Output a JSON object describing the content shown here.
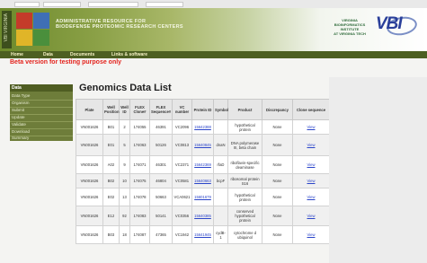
{
  "browser": {},
  "banner": {
    "side_label": "VBI VIRGINIA",
    "title_line1": "ADMINISTRATIVE RESOURCE FOR",
    "title_line2": "BIODEFENSE PROTEOMIC RESEARCH CENTERS",
    "vbi_sub_line1": "VIRGINIA",
    "vbi_sub_line2": "BIOINFORMATICS",
    "vbi_sub_line3": "INSTITUTE",
    "vbi_sub_line4": "AT VIRGINIA TECH",
    "vbi_logo": "VBI",
    "logo_colors": [
      "#c43b2a",
      "#3f6fb5",
      "#e0b528",
      "#4a8f3c"
    ]
  },
  "nav": {
    "items": [
      "Home",
      "Data",
      "Documents",
      "Links & software"
    ]
  },
  "beta_notice": "Beta version for testing purpose only",
  "sidebar": {
    "header": "Data",
    "items": [
      "Data Type",
      "Organism",
      "Submit",
      "Update",
      "Validate",
      "Download",
      "Summary"
    ]
  },
  "page_title": "Genomics Data List",
  "table": {
    "headers": [
      "Plate",
      "Well Position",
      "Well ID",
      "FLEX Clone#",
      "FLEX Sequence#",
      "VC number",
      "Protein ID",
      "Symbol",
      "Product",
      "Discrepancy",
      "Clone sequence"
    ],
    "rows": [
      [
        "VN001626",
        "B01",
        "2",
        "174055",
        "46391",
        "VC2096",
        "15642388",
        "",
        "hypothetical protein",
        "None",
        "View"
      ],
      [
        "VN001626",
        "E01",
        "5",
        "174063",
        "50126",
        "VC0813",
        "15640845",
        "dnaN",
        "DNA polymerase III, beta chain",
        "None",
        "View"
      ],
      [
        "VN001626",
        "A02",
        "9",
        "174071",
        "46301",
        "VC2371",
        "15642369",
        "rfaD",
        "riboflavin-specific deaminase",
        "None",
        "View"
      ],
      [
        "VN001626",
        "B02",
        "10",
        "174075",
        "46804",
        "VC0581",
        "15640663",
        "bcpF",
        "ribosomal protein S16",
        "None",
        "View"
      ],
      [
        "VN001626",
        "E02",
        "13",
        "174078",
        "50663",
        "VCA0621",
        "15601679",
        "",
        "hypothetical protein",
        "None",
        "View"
      ],
      [
        "VN001626",
        "E12",
        "92",
        "174083",
        "50141",
        "VC0356",
        "15640385",
        "",
        "conserved hypothetical protein",
        "None",
        "View"
      ],
      [
        "VN001626",
        "B03",
        "18",
        "174087",
        "47365",
        "VC1942",
        "15641945",
        "cydB-1",
        "cytochrome d ubiquinol",
        "None",
        "View"
      ]
    ]
  }
}
